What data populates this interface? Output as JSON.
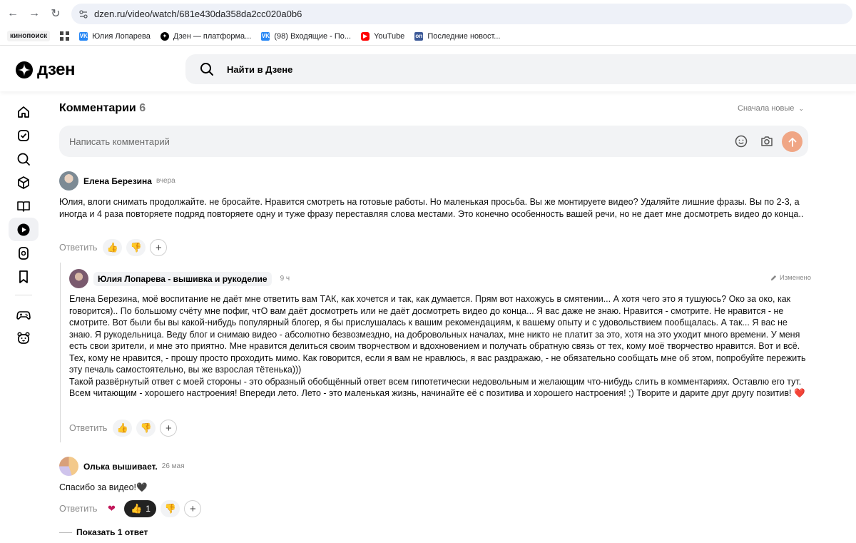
{
  "browser": {
    "url": "dzen.ru/video/watch/681e430da358da2cc020a0b6",
    "bookmarks": [
      {
        "label": "кинопоиск",
        "icon": "kinopoisk-logo",
        "color": "#f2f2f2"
      },
      {
        "label": "",
        "icon": "apps-grid-icon",
        "color": "#444444"
      },
      {
        "label": "Юлия Лопарева",
        "icon": "vk-icon",
        "color": "#2787f5"
      },
      {
        "label": "Дзен — платформа...",
        "icon": "dzen-icon",
        "color": "#000000"
      },
      {
        "label": "(98) Входящие - По...",
        "icon": "vk-icon",
        "color": "#2787f5"
      },
      {
        "label": "YouTube",
        "icon": "youtube-icon",
        "color": "#ff0000"
      },
      {
        "label": "Последние новост...",
        "icon": "news-icon",
        "color": "#3d5a98"
      }
    ]
  },
  "header": {
    "logo_text": "дзен",
    "search_placeholder": "Найти в Дзене"
  },
  "rail": {
    "items": [
      "home-icon",
      "subscriptions-icon",
      "search-icon",
      "cube-icon",
      "book-icon",
      "video-icon",
      "shorts-icon",
      "bookmark-icon",
      "gamepad-icon",
      "kids-icon"
    ],
    "active_index": 5
  },
  "comments_section": {
    "title": "Комментарии",
    "count": "6",
    "sort_label": "Сначала новые",
    "composer_placeholder": "Написать комментарий",
    "accent_color": "#f0a685"
  },
  "comments": [
    {
      "author": "Елена Березина",
      "time": "вчера",
      "text": "Юлия, влоги снимать продолжайте. не бросайте. Нравится смотреть на готовые работы. Но маленькая просьба. Вы же монтируете видео? Удаляйте лишние фразы. Вы по 2-3, а иногда и 4 раза повторяете подряд повторяете одну и туже фразу переставляя слова местами. Это конечно особенность вашей речи, но не дает мне досмотреть видео до конца..",
      "reply_label": "Ответить"
    },
    {
      "author": "Юлия Лопарева - вышивка и рукоделие",
      "time": "9 ч",
      "edited_label": "Изменено",
      "text_lines": [
        "Елена Березина, моё воспитание не даёт мне ответить вам ТАК, как хочется и так, как думается. Прям вот нахожусь в смятении... А хотя чего это я тушуюсь? Око за око, как говорится).. По большому счёту мне пофиг, чтО вам даёт досмотреть или не даёт досмотреть видео до конца... Я вас даже не знаю. Нравится - смотрите. Не нравится - не смотрите. Вот были бы вы какой-нибудь популярный блогер, я бы прислушалась к вашим рекомендациям, к вашему опыту и с удовольствием пообщалась. А так... Я вас не знаю. Я рукодельница. Веду блог и снимаю видео - абсолютно безвозмездно, на добровольных началах, мне никто не платит за это, хотя на это уходит много времени. У меня есть свои зрители, и мне это приятно. Мне нравится делиться своим творчеством и вдохновением и получать обратную связь от тех, кому моё творчество нравится. Вот и всё. Тех, кому не нравится, - прошу просто проходить мимо. Как говорится, если я вам не нравлюсь, я вас раздражаю, - не обязательно сообщать мне об этом, попробуйте пережить эту печаль самостоятельно, вы же взрослая тётенька)))",
        "Такой развёрнутый ответ с моей стороны - это образный обобщённый ответ всем гипотетически недовольным и желающим что-нибудь слить в комментариях. Оставлю его тут. Всем читающим - хорошего настроения! Впереди лето. Лето - это маленькая жизнь, начинайте её с позитива и хорошего настроения! ;) Творите и дарите друг другу позитив!"
      ],
      "reply_label": "Ответить"
    },
    {
      "author": "Олька вышивает.",
      "time": "26 мая",
      "text": "Спасибо за видео!🖤",
      "reply_label": "Ответить",
      "likes": "1"
    }
  ],
  "show_replies_label": "Показать 1 ответ"
}
